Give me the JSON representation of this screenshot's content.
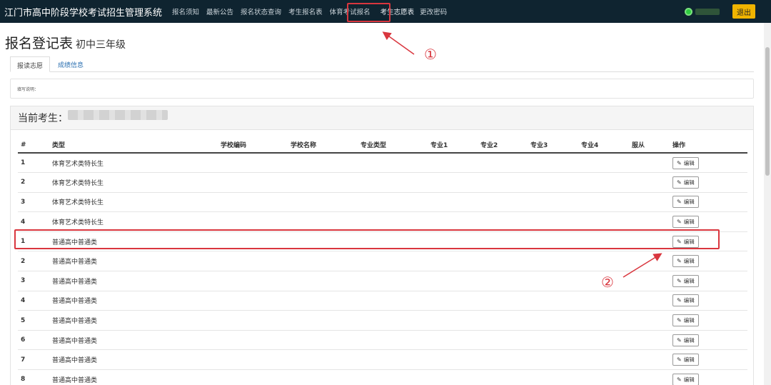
{
  "navbar": {
    "brand": "江门市高中阶段学校考试招生管理系统",
    "items": [
      {
        "label": "报名须知"
      },
      {
        "label": "最新公告"
      },
      {
        "label": "报名状态查询"
      },
      {
        "label": "考生报名表"
      },
      {
        "label": "体育考试报名"
      },
      {
        "label": "考生志愿表"
      },
      {
        "label": "更改密码"
      }
    ],
    "logout_label": "退出"
  },
  "page": {
    "title": "报名登记表",
    "subtitle": "初中三年级"
  },
  "tabs": [
    {
      "label": "报读志愿"
    },
    {
      "label": "成绩信息"
    }
  ],
  "note": "填写说明：",
  "panel": {
    "heading": "当前考生："
  },
  "table": {
    "headers": [
      "#",
      "类型",
      "学校编码",
      "学校名称",
      "专业类型",
      "专业1",
      "专业2",
      "专业3",
      "专业4",
      "服从",
      "操作"
    ],
    "edit_label": "编辑",
    "rows": [
      {
        "num": "1",
        "type": "体育艺术类特长生"
      },
      {
        "num": "2",
        "type": "体育艺术类特长生"
      },
      {
        "num": "3",
        "type": "体育艺术类特长生"
      },
      {
        "num": "4",
        "type": "体育艺术类特长生"
      },
      {
        "num": "1",
        "type": "普通高中普通类"
      },
      {
        "num": "2",
        "type": "普通高中普通类"
      },
      {
        "num": "3",
        "type": "普通高中普通类"
      },
      {
        "num": "4",
        "type": "普通高中普通类"
      },
      {
        "num": "5",
        "type": "普通高中普通类"
      },
      {
        "num": "6",
        "type": "普通高中普通类"
      },
      {
        "num": "7",
        "type": "普通高中普通类"
      },
      {
        "num": "8",
        "type": "普通高中普通类"
      }
    ]
  },
  "annotations": {
    "marker1": "①",
    "marker2": "②",
    "color": "#d9363e"
  }
}
